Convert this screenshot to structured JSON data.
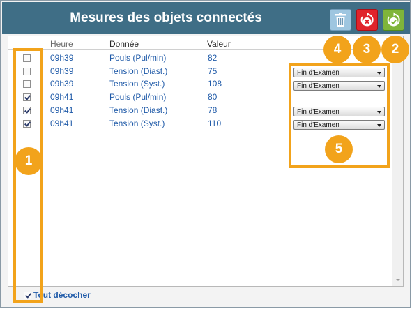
{
  "window": {
    "title": "Mesures des objets connectés"
  },
  "toolbar": {
    "delete_icon": "trash-icon",
    "cancel_icon": "cancel-icon",
    "validate_icon": "validate-icon"
  },
  "columns": {
    "time": "Heure",
    "data": "Donnée",
    "value": "Valeur"
  },
  "rows": [
    {
      "checked": false,
      "time": "09h39",
      "data": "Pouls (Pul/min)",
      "value": "82"
    },
    {
      "checked": false,
      "time": "09h39",
      "data": "Tension (Diast.)",
      "value": "75"
    },
    {
      "checked": false,
      "time": "09h39",
      "data": "Tension (Syst.)",
      "value": "108"
    },
    {
      "checked": true,
      "time": "09h41",
      "data": "Pouls (Pul/min)",
      "value": "80"
    },
    {
      "checked": true,
      "time": "09h41",
      "data": "Tension (Diast.)",
      "value": "78"
    },
    {
      "checked": true,
      "time": "09h41",
      "data": "Tension (Syst.)",
      "value": "110"
    }
  ],
  "selects": [
    "Fin d'Examen",
    "Fin d'Examen",
    "Fin d'Examen",
    "Fin d'Examen"
  ],
  "footer": {
    "checked": true,
    "label": "Tout décocher"
  },
  "badges": [
    "1",
    "2",
    "3",
    "4",
    "5"
  ],
  "colors": {
    "titlebar": "#3f6e86",
    "highlight": "#f2a31b",
    "link_text": "#1f5aa8",
    "cancel": "#e0232b",
    "validate": "#7fb53a",
    "delete": "#9ec6e0"
  }
}
